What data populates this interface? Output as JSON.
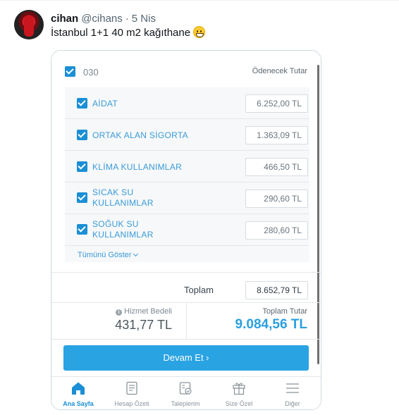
{
  "tweet": {
    "name": "cihan",
    "handle": "@cihans",
    "separator": "·",
    "date": "5 Nis",
    "text": "İstanbul 1+1 40 m2 kağıthane",
    "emoji_icon": "grinning-face-emoji"
  },
  "app": {
    "account": {
      "label": "030",
      "column_header": "Ödenecek Tutar",
      "checked": true
    },
    "items": [
      {
        "label": "AİDAT",
        "amount": "6.252,00 TL",
        "checked": true
      },
      {
        "label": "ORTAK ALAN SİGORTA",
        "amount": "1.363,09 TL",
        "checked": true
      },
      {
        "label": "KLİMA KULLANIMLAR",
        "amount": "466,50 TL",
        "checked": true
      },
      {
        "label": "SICAK SU KULLANIMLAR",
        "amount": "290,60 TL",
        "checked": true
      },
      {
        "label": "SOĞUK SU KULLANIMLAR",
        "amount": "280,60 TL",
        "checked": true
      }
    ],
    "show_all": "Tümünü Göster",
    "total": {
      "label": "Toplam",
      "value": "8.652,79 TL"
    },
    "service_fee": {
      "label": "Hizmet Bedeli",
      "value": "431,77 TL"
    },
    "grand_total": {
      "label": "Toplam Tutar",
      "value": "9.084,56 TL"
    },
    "continue_button": "Devam Et ›",
    "tabs": [
      {
        "label": "Ana Sayfa",
        "icon": "home-icon",
        "active": true
      },
      {
        "label": "Hesap Özeti",
        "icon": "statement-icon",
        "active": false
      },
      {
        "label": "Taleplerim",
        "icon": "requests-icon",
        "active": false
      },
      {
        "label": "Size Özel",
        "icon": "gift-icon",
        "active": false
      },
      {
        "label": "Diğer",
        "icon": "menu-icon",
        "active": false
      }
    ],
    "colors": {
      "accent": "#2aa3e2",
      "checkbox": "#1a8fd6",
      "grand_total": "#2aa0e0"
    }
  }
}
